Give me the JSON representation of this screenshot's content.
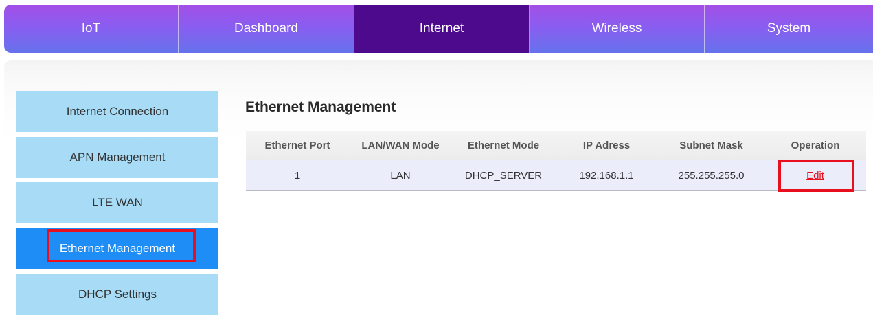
{
  "topnav": {
    "tabs": [
      {
        "label": "IoT"
      },
      {
        "label": "Dashboard"
      },
      {
        "label": "Internet"
      },
      {
        "label": "Wireless"
      },
      {
        "label": "System"
      }
    ],
    "active_tab": "Internet"
  },
  "sidebar": {
    "items": [
      {
        "label": "Internet Connection"
      },
      {
        "label": "APN Management"
      },
      {
        "label": "LTE WAN"
      },
      {
        "label": "Ethernet Management"
      },
      {
        "label": "DHCP Settings"
      }
    ],
    "active_item": "Ethernet Management"
  },
  "main": {
    "title": "Ethernet Management",
    "table": {
      "headers": [
        "Ethernet Port",
        "LAN/WAN Mode",
        "Ethernet Mode",
        "IP Adress",
        "Subnet Mask",
        "Operation"
      ],
      "rows": [
        {
          "port": "1",
          "lan_wan_mode": "LAN",
          "ethernet_mode": "DHCP_SERVER",
          "ip": "192.168.1.1",
          "mask": "255.255.255.0",
          "operation": "Edit"
        }
      ]
    }
  },
  "colors": {
    "nav_gradient_top": "#a34fe6",
    "nav_gradient_bottom": "#6672ec",
    "nav_active": "#4d0a8d",
    "sidebar_item": "#a8dcf6",
    "sidebar_active": "#1f8df6",
    "highlight": "#e8101f"
  }
}
